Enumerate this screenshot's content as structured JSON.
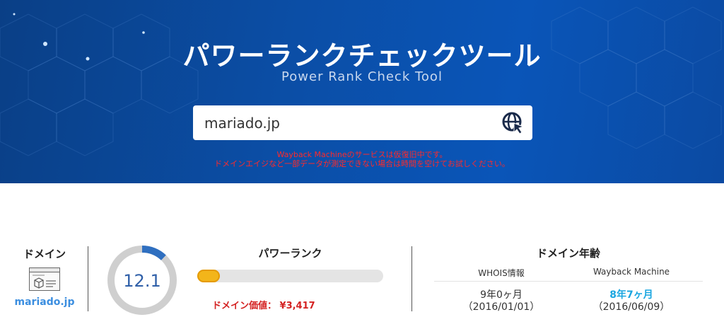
{
  "hero": {
    "title": "パワーランクチェックツール",
    "subtitle": "Power Rank Check Tool"
  },
  "search": {
    "value": "mariado.jp",
    "button_icon": "globe-cursor-icon"
  },
  "notice": {
    "line1": "Wayback Machineのサービスは仮復旧中です。",
    "line2": "ドメインエイジなど一部データが測定できない場合は時間を空けてお試しください。"
  },
  "domain_section": {
    "title": "ドメイン",
    "icon": "webpage-icon",
    "domain": "mariado.jp"
  },
  "power_rank": {
    "title": "パワーランク",
    "score": "12.1",
    "score_fraction": 0.121,
    "bar_fraction": 0.12,
    "value_text": "ドメイン価値： ¥3,417"
  },
  "domain_age": {
    "title": "ドメイン年齢",
    "whois_label": "WHOIS情報",
    "wayback_label": "Wayback Machine",
    "whois_age": "9年0ヶ月",
    "whois_date": "（2016/01/01）",
    "wayback_age": "8年7ヶ月",
    "wayback_date": "（2016/06/09）"
  },
  "colors": {
    "hero_blue": "#0b4ea6",
    "notice_red": "#ff2a2a",
    "link_blue": "#3b8ee0",
    "gauge_blue": "#2f6fc0",
    "bar_yellow": "#f3b51a",
    "wayback_cyan": "#1aa6e0",
    "value_red": "#d42222"
  }
}
